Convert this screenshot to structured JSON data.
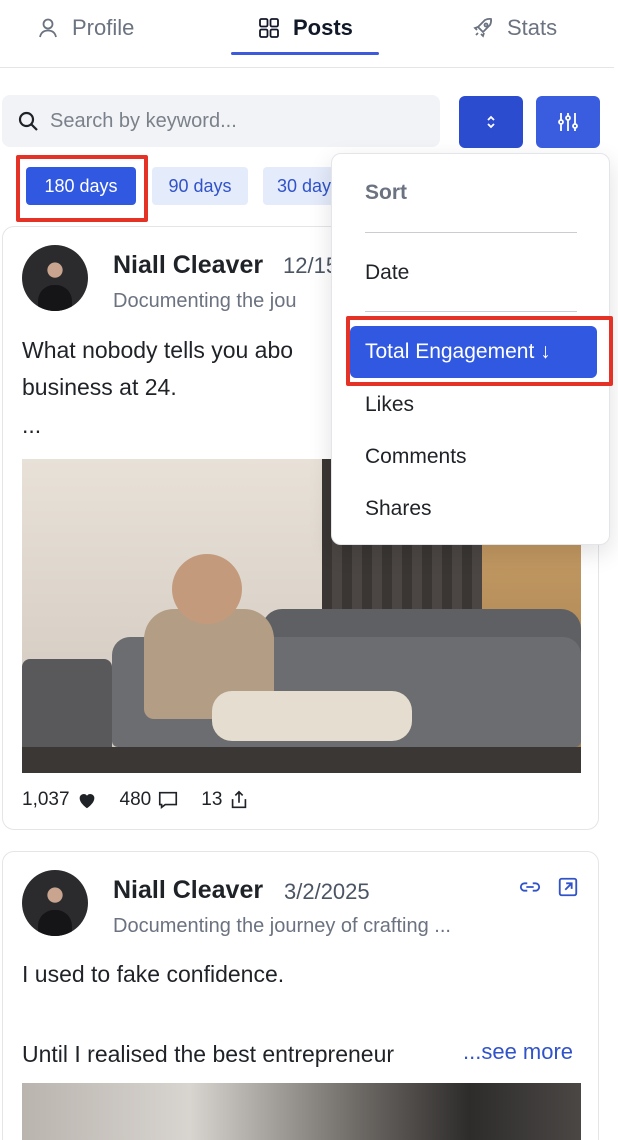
{
  "tabs": [
    {
      "label": "Profile",
      "icon": "user-icon"
    },
    {
      "label": "Posts",
      "icon": "grid-icon",
      "active": true
    },
    {
      "label": "Stats",
      "icon": "rocket-icon"
    }
  ],
  "search": {
    "placeholder": "Search by keyword..."
  },
  "chips": [
    "180 days",
    "90 days",
    "30 days"
  ],
  "sort_menu": {
    "title": "Sort",
    "items": [
      "Date",
      "Total Engagement ↓",
      "Likes",
      "Comments",
      "Shares"
    ],
    "selected": "Total Engagement ↓"
  },
  "posts": [
    {
      "author": "Niall Cleaver",
      "date": "12/15",
      "headline": "Documenting the jou",
      "text_line1": "What nobody tells you abo",
      "text_line2": "business at 24.",
      "text_line3": "...",
      "likes": "1,037",
      "comments": "480",
      "shares": "13"
    },
    {
      "author": "Niall Cleaver",
      "date": "3/2/2025",
      "headline": "Documenting the journey of crafting ...",
      "text_line1": "I used to fake confidence.",
      "text_line2": "Until I realised the best entrepreneur",
      "see_more": "...see more"
    }
  ],
  "colors": {
    "accent": "#3158e0",
    "highlight": "#e53226",
    "chip_bg": "#e4ebfb"
  }
}
